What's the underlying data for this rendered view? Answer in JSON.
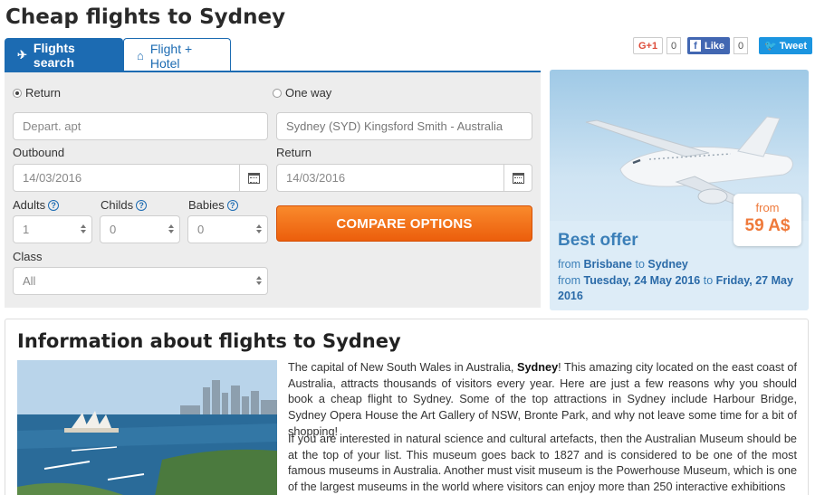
{
  "page": {
    "title": "Cheap flights to Sydney"
  },
  "tabs": [
    {
      "label": "Flights search",
      "icon": "plane-icon",
      "active": true
    },
    {
      "label": "Flight + Hotel",
      "icon": "hotel-icon",
      "active": false
    }
  ],
  "search": {
    "trip_types": [
      {
        "label": "Return",
        "selected": true
      },
      {
        "label": "One way",
        "selected": false
      }
    ],
    "departure_placeholder": "Depart. apt",
    "destination_value": "Sydney (SYD) Kingsford Smith - Australia",
    "outbound_label": "Outbound",
    "outbound_value": "14/03/2016",
    "return_label": "Return",
    "return_value": "14/03/2016",
    "adults_label": "Adults",
    "adults_value": "1",
    "childs_label": "Childs",
    "childs_value": "0",
    "babies_label": "Babies",
    "babies_value": "0",
    "class_label": "Class",
    "class_value": "All",
    "compare_label": "COMPARE OPTIONS"
  },
  "social": {
    "gplus_label": "G+1",
    "gplus_count": "0",
    "fb_label": "Like",
    "fb_count": "0",
    "tweet_label": "Tweet"
  },
  "offer": {
    "from_label": "from",
    "price": "59 A$",
    "title": "Best offer",
    "route_from_word": "from",
    "route_origin": "Brisbane",
    "route_to_word": "to",
    "route_destination": "Sydney",
    "dates_from_word": "from",
    "date_start": "Tuesday, 24 May 2016",
    "dates_to_word": "to",
    "date_end": "Friday, 27 May 2016"
  },
  "info": {
    "title": "Information about flights to Sydney",
    "p1_a": "The capital of New South Wales in Australia, ",
    "p1_bold": "Sydney",
    "p1_b": "! This amazing city located on the east coast of Australia, attracts thousands of visitors every year. Here are just a few reasons why you should book a cheap flight to Sydney. Some of the top attractions in Sydney include Harbour Bridge, Sydney Opera House the Art Gallery of NSW, Bronte Park, and why not leave some time for a bit of shopping!",
    "p2": "If you are interested in natural science and cultural artefacts, then the Australian Museum should be at the top of your list. This museum goes back to 1827 and is considered to be one of the most famous museums in Australia. Another must visit museum is the Powerhouse Museum, which is one of the largest museums in the world where visitors can enjoy more than 250 interactive exhibitions"
  },
  "colors": {
    "brand_blue": "#1c6bb2",
    "cta_orange": "#f47a20",
    "price_orange": "#ef7a3b"
  }
}
